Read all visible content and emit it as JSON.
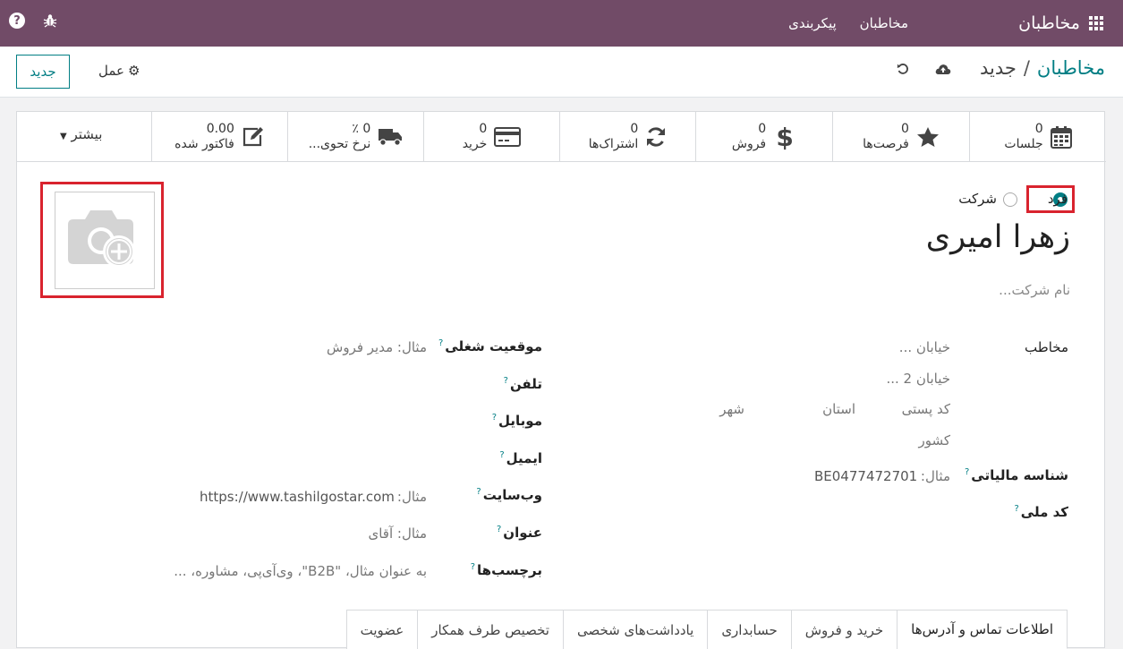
{
  "topbar": {
    "app_name": "مخاطبان",
    "menu": [
      "مخاطبان",
      "پیکربندی"
    ],
    "icons": [
      "apps-grid-icon",
      "help-icon",
      "bug-icon"
    ]
  },
  "control": {
    "breadcrumb_parent": "مخاطبان",
    "breadcrumb_sep": "/",
    "breadcrumb_current": "جدید",
    "new_button": "جدید",
    "action_button": "عمل"
  },
  "stats": [
    {
      "value": "0",
      "label": "جلسات",
      "icon": "calendar-icon"
    },
    {
      "value": "0",
      "label": "فرصت‌ها",
      "icon": "star-icon"
    },
    {
      "value": "0",
      "label": "فروش",
      "icon": "dollar-icon"
    },
    {
      "value": "0",
      "label": "اشتراک‌ها",
      "icon": "refresh-icon"
    },
    {
      "value": "0",
      "label": "خرید",
      "icon": "credit-card-icon"
    },
    {
      "value": "0 ٪",
      "label": "نرخ تحوی...",
      "icon": "truck-icon"
    },
    {
      "value": "0.00",
      "label": "فاکتور شده",
      "icon": "edit-icon"
    }
  ],
  "more_button": "بیشتر",
  "form": {
    "type_individual": "فرد",
    "type_company": "شرکت",
    "name": "زهرا امیری",
    "company_placeholder": "نام شرکت...",
    "address_label": "مخاطب",
    "street_placeholder": "خیابان ...",
    "street2_placeholder": "خیابان 2 ...",
    "zip_placeholder": "کد پستی",
    "state_placeholder": "استان",
    "city_placeholder": "شهر",
    "country_placeholder": "کشور",
    "vat_label": "شناسه مالیاتی",
    "vat_prefix": "مثال:",
    "vat_example": "BE0477472701",
    "national_id_label": "کد ملی",
    "job_label": "موقعیت شغلی",
    "job_placeholder": "مثال: مدیر فروش",
    "phone_label": "تلفن",
    "mobile_label": "موبایل",
    "email_label": "ایمیل",
    "website_label": "وب‌سایت",
    "website_prefix": "مثال:",
    "website_example": "https://www.tashilgostar.com",
    "title_label": "عنوان",
    "title_placeholder": "مثال: آقای",
    "tags_label": "برچسب‌ها",
    "tags_placeholder": "به عنوان مثال، \"B2B\"، وی‌آی‌پی، مشاوره، ...",
    "help_mark": "?"
  },
  "tabs": [
    "اطلاعات تماس و آدرس‌ها",
    "خرید و فروش",
    "حسابداری",
    "یادداشت‌های شخصی",
    "تخصیص طرف همکار",
    "عضویت"
  ],
  "colors": {
    "brand": "#714b67",
    "accent": "#017e84",
    "highlight": "#d9232e"
  }
}
